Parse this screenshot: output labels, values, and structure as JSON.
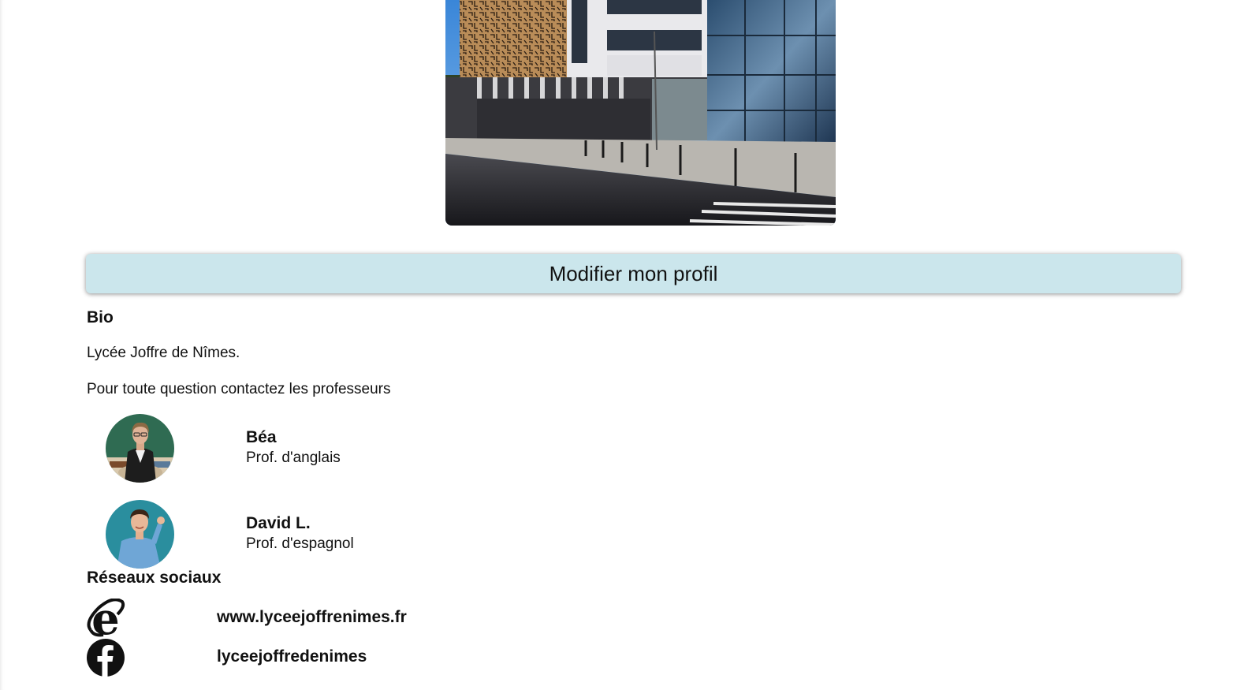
{
  "header_photo": {
    "icon": "school-building-photo"
  },
  "profile": {
    "edit_label": "Modifier mon profil"
  },
  "bio": {
    "heading": "Bio",
    "line1": "Lycée Joffre de Nîmes.",
    "line2": "Pour toute question contactez les professeurs"
  },
  "contacts": [
    {
      "name": "Béa",
      "role": "Prof. d'anglais",
      "icon": "avatar-bea"
    },
    {
      "name": "David L.",
      "role": "Prof. d'espagnol",
      "icon": "avatar-david"
    }
  ],
  "social": {
    "heading": "Réseaux sociaux",
    "items": [
      {
        "icon": "internet-explorer-icon",
        "label": "www.lyceejoffrenimes.fr"
      },
      {
        "icon": "facebook-icon",
        "label": "lyceejoffredenimes"
      }
    ]
  },
  "colors": {
    "button_bg": "#cbe6ec",
    "text": "#111111"
  }
}
